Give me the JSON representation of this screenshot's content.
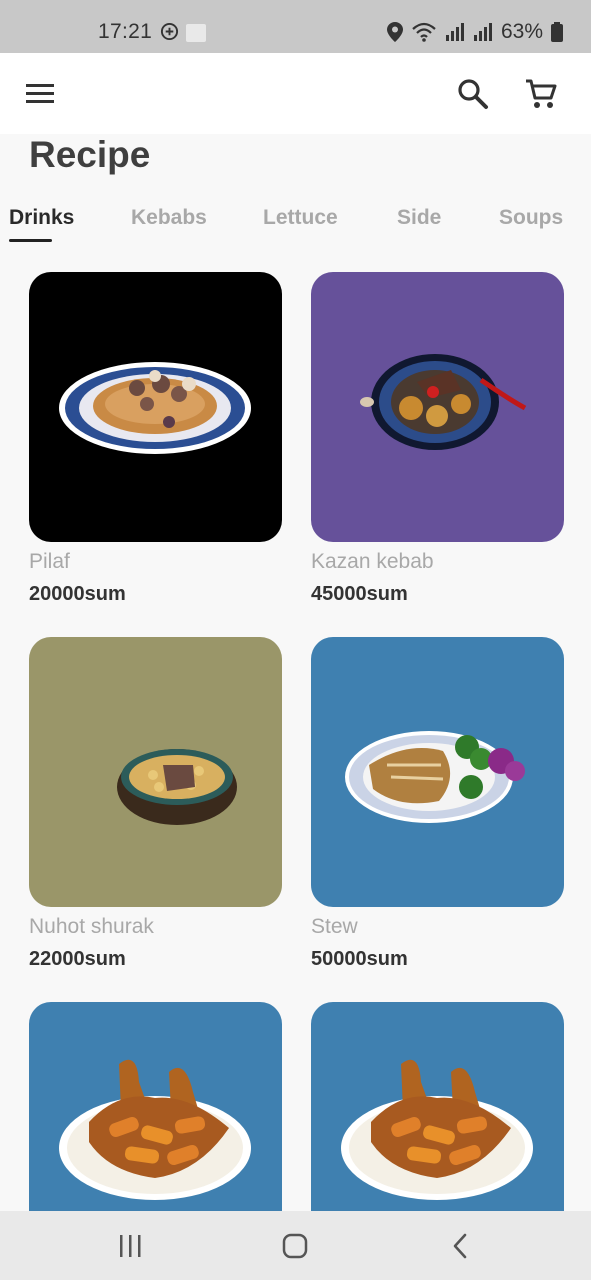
{
  "status_bar": {
    "time": "17:21",
    "battery": "63%",
    "icons": [
      "whatsapp-icon",
      "notification-icon",
      "location-icon",
      "wifi-icon",
      "signal-icon",
      "signal-icon",
      "battery-icon"
    ]
  },
  "app_bar": {
    "icons": [
      "menu-icon",
      "search-icon",
      "cart-icon"
    ]
  },
  "page": {
    "title": "Recipe"
  },
  "tabs": [
    {
      "label": "Drinks",
      "active": true
    },
    {
      "label": "Kebabs",
      "active": false
    },
    {
      "label": "Lettuce",
      "active": false
    },
    {
      "label": "Side",
      "active": false
    },
    {
      "label": "Soups",
      "active": false
    }
  ],
  "products": [
    {
      "name": "Pilaf",
      "price": "20000sum",
      "bg": "#000000"
    },
    {
      "name": "Kazan kebab",
      "price": "45000sum",
      "bg": "#66519a"
    },
    {
      "name": "Nuhot shurak",
      "price": "22000sum",
      "bg": "#9a9669"
    },
    {
      "name": "Stew",
      "price": "50000sum",
      "bg": "#3f80b0"
    },
    {
      "name": "",
      "price": "",
      "bg": "#3f80b0"
    },
    {
      "name": "",
      "price": "",
      "bg": "#3f80b0"
    }
  ],
  "nav_bar": {
    "icons": [
      "recent-apps-icon",
      "home-icon",
      "back-icon"
    ]
  }
}
